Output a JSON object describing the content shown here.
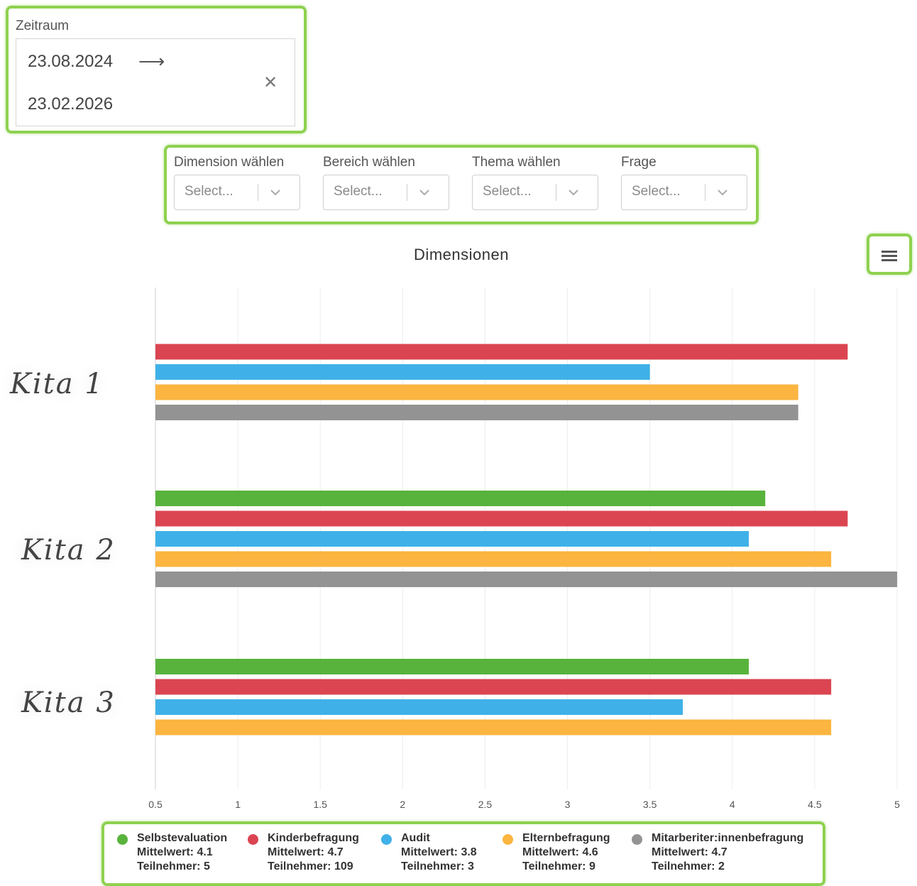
{
  "daterange": {
    "label": "Zeitraum",
    "start": "23.08.2024",
    "end": "23.02.2026",
    "arrow_icon": "arrow-right-icon",
    "clear_icon": "close-icon"
  },
  "filters": [
    {
      "label": "Dimension wählen",
      "placeholder": "Select..."
    },
    {
      "label": "Bereich wählen",
      "placeholder": "Select..."
    },
    {
      "label": "Thema wählen",
      "placeholder": "Select..."
    },
    {
      "label": "Frage",
      "placeholder": "Select..."
    }
  ],
  "menu_icon": "hamburger-menu-icon",
  "highlight_color": "#8ed14f",
  "chart_data": {
    "type": "bar",
    "orientation": "horizontal",
    "title": "Dimensionen",
    "categories": [
      "Kita 1",
      "Kita 2",
      "Kita 3"
    ],
    "xlim": [
      0.5,
      5
    ],
    "xticks": [
      "0.5",
      "1",
      "1.5",
      "2",
      "2.5",
      "3",
      "3.5",
      "4",
      "4.5",
      "5"
    ],
    "grid": true,
    "legend_position": "bottom",
    "series": [
      {
        "name": "Selbstevaluation",
        "color": "#58b33c",
        "values": [
          null,
          4.2,
          4.1
        ],
        "stat1": "Mittelwert: 4.1",
        "stat2": "Teilnehmer: 5"
      },
      {
        "name": "Kinderbefragung",
        "color": "#db4551",
        "values": [
          4.7,
          4.7,
          4.6
        ],
        "stat1": "Mittelwert: 4.7",
        "stat2": "Teilnehmer: 109"
      },
      {
        "name": "Audit",
        "color": "#3fb1e8",
        "values": [
          3.5,
          4.1,
          3.7
        ],
        "stat1": "Mittelwert: 3.8",
        "stat2": "Teilnehmer: 3"
      },
      {
        "name": "Elternbefragung",
        "color": "#fbb540",
        "values": [
          4.4,
          4.6,
          4.6
        ],
        "stat1": "Mittelwert: 4.6",
        "stat2": "Teilnehmer: 9"
      },
      {
        "name": "Mitarberiter:innenbefragung",
        "color": "#939393",
        "values": [
          4.4,
          5.0,
          null
        ],
        "stat1": "Mittelwert: 4.7",
        "stat2": "Teilnehmer: 2"
      }
    ]
  }
}
